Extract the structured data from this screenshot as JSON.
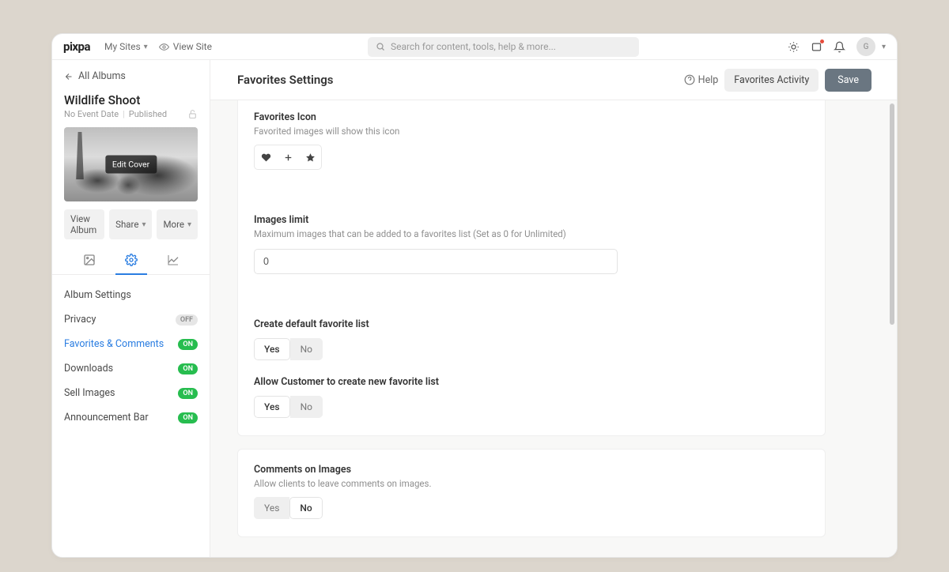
{
  "topbar": {
    "brand": "pixpa",
    "my_sites": "My Sites",
    "view_site": "View Site",
    "search_placeholder": "Search for content, tools, help & more...",
    "avatar_initial": "G"
  },
  "sidebar": {
    "back_label": "All Albums",
    "album_title": "Wildlife Shoot",
    "meta_date": "No Event Date",
    "meta_status": "Published",
    "edit_cover": "Edit Cover",
    "actions": {
      "view_album": "View Album",
      "share": "Share",
      "more": "More"
    },
    "nav": [
      {
        "label": "Album Settings",
        "state": ""
      },
      {
        "label": "Privacy",
        "state": "OFF"
      },
      {
        "label": "Favorites & Comments",
        "state": "ON"
      },
      {
        "label": "Downloads",
        "state": "ON"
      },
      {
        "label": "Sell Images",
        "state": "ON"
      },
      {
        "label": "Announcement Bar",
        "state": "ON"
      }
    ]
  },
  "main": {
    "title": "Favorites Settings",
    "help": "Help",
    "favorites_activity": "Favorites Activity",
    "save": "Save"
  },
  "settings": {
    "fav_icon": {
      "label": "Favorites Icon",
      "help": "Favorited images will show this icon"
    },
    "images_limit": {
      "label": "Images limit",
      "help": "Maximum images that can be added to a favorites list (Set as 0 for Unlimited)",
      "value": "0"
    },
    "default_list": {
      "label": "Create default favorite list",
      "yes": "Yes",
      "no": "No"
    },
    "allow_create": {
      "label": "Allow Customer to create new favorite list",
      "yes": "Yes",
      "no": "No"
    },
    "comments": {
      "label": "Comments on Images",
      "help": "Allow clients to leave comments on images.",
      "yes": "Yes",
      "no": "No"
    }
  }
}
